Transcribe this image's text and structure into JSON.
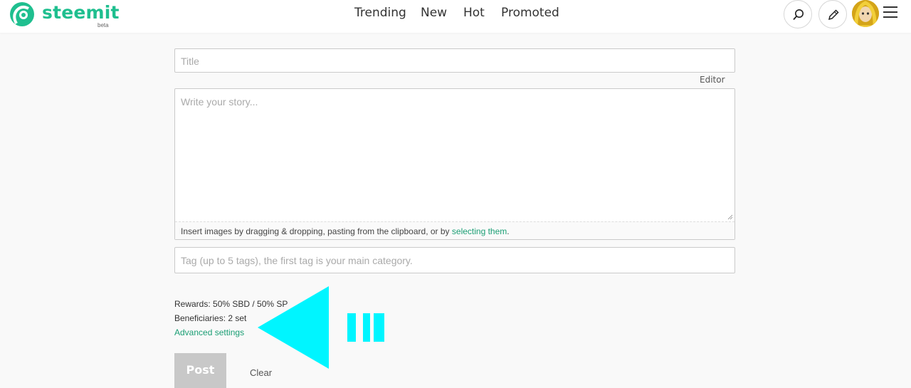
{
  "header": {
    "logo_text": "steemit",
    "logo_badge": "beta",
    "nav": [
      "Trending",
      "New",
      "Hot",
      "Promoted"
    ],
    "icons": [
      "search-icon",
      "pencil-icon",
      "avatar",
      "menu-icon"
    ],
    "brand_color": "#1fbf8f"
  },
  "editor": {
    "title_placeholder": "Title",
    "editor_toggle": "Editor",
    "body_placeholder": "Write your story...",
    "dropzone_text": "Insert images by dragging & dropping, pasting from the clipboard, or by ",
    "dropzone_link": "selecting them",
    "dropzone_end": ".",
    "tags_placeholder": "Tag (up to 5 tags), the first tag is your main category.",
    "rewards": "Rewards: 50% SBD / 50% SP",
    "beneficiaries": "Beneficiaries: 2 set",
    "advanced": "Advanced settings",
    "post_label": "Post",
    "clear_label": "Clear"
  },
  "annotation": {
    "arrow_color": "#00f5ff"
  }
}
